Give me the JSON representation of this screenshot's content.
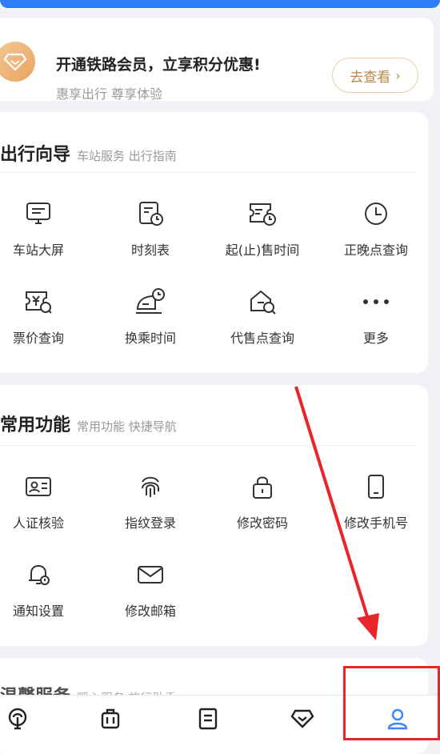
{
  "promo": {
    "title": "开通铁路会员，立享积分优惠!",
    "subtitle": "惠享出行 尊享体验",
    "button_label": "去查看"
  },
  "travel_guide": {
    "title": "出行向导",
    "hint": "车站服务 出行指南",
    "items": [
      {
        "label": "车站大屏",
        "icon": "station-screen-icon"
      },
      {
        "label": "时刻表",
        "icon": "timetable-icon"
      },
      {
        "label": "起(止)售时间",
        "icon": "ticket-sale-time-icon"
      },
      {
        "label": "正晚点查询",
        "icon": "clock-icon"
      },
      {
        "label": "票价查询",
        "icon": "fare-query-icon"
      },
      {
        "label": "换乘时间",
        "icon": "transfer-time-icon"
      },
      {
        "label": "代售点查询",
        "icon": "agency-query-icon"
      },
      {
        "label": "更多",
        "icon": "more-icon"
      }
    ]
  },
  "common_functions": {
    "title": "常用功能",
    "hint": "常用功能 快捷导航",
    "items": [
      {
        "label": "人证核验",
        "icon": "id-card-icon"
      },
      {
        "label": "指纹登录",
        "icon": "fingerprint-icon"
      },
      {
        "label": "修改密码",
        "icon": "lock-icon"
      },
      {
        "label": "修改手机号",
        "icon": "phone-icon"
      },
      {
        "label": "通知设置",
        "icon": "bell-icon"
      },
      {
        "label": "修改邮箱",
        "icon": "mail-icon"
      }
    ]
  },
  "next_section": {
    "title": "温馨服务",
    "hint": "暖心服务 旅行助手"
  },
  "bottom_nav": [
    "home-icon",
    "luggage-icon",
    "orders-icon",
    "member-icon",
    "profile-icon"
  ],
  "colors": {
    "accent": "#2f7df6",
    "gold": "#b78a4a",
    "annotation": "#e8262a"
  }
}
